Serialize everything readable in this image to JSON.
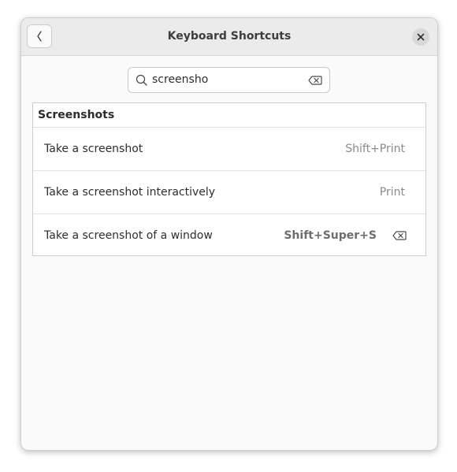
{
  "window": {
    "title": "Keyboard Shortcuts"
  },
  "icons": {
    "back": "go-previous-icon",
    "close": "window-close-icon",
    "search": "search-icon",
    "clear": "edit-clear-icon",
    "reset": "reset-shortcut-icon"
  },
  "search": {
    "value": "screensho"
  },
  "section": {
    "title": "Screenshots",
    "rows": [
      {
        "label": "Take a screenshot",
        "shortcut": "Shift+Print",
        "customized": false
      },
      {
        "label": "Take a screenshot interactively",
        "shortcut": "Print",
        "customized": false
      },
      {
        "label": "Take a screenshot of a window",
        "shortcut": "Shift+Super+S",
        "customized": true
      }
    ]
  },
  "colors": {
    "headerbar": "#ebebeb",
    "window_bg": "#fafafa",
    "list_bg": "#ffffff"
  }
}
